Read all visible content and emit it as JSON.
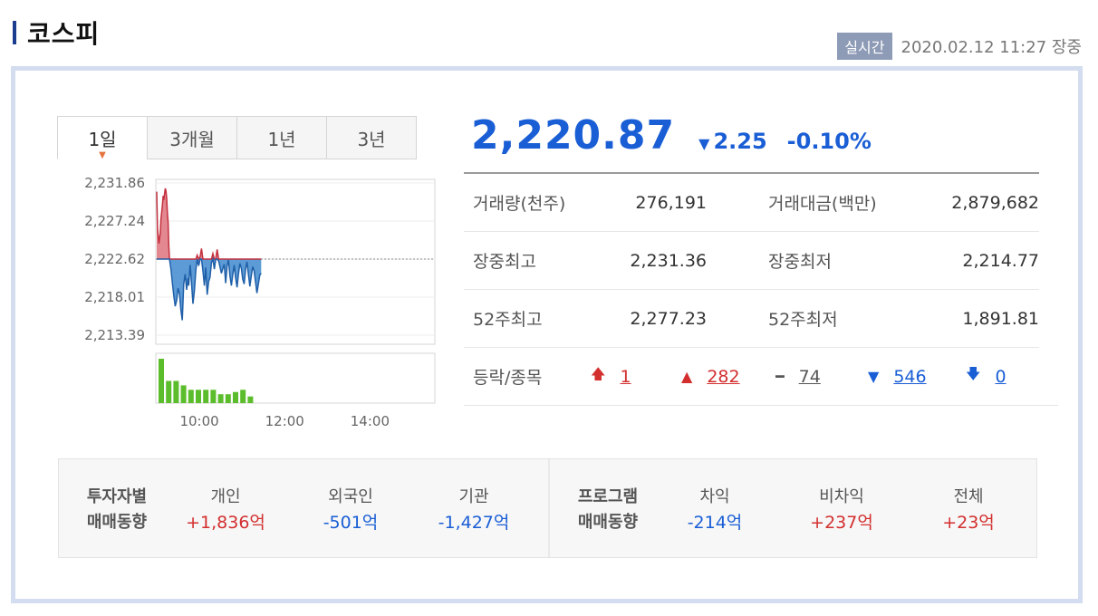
{
  "header": {
    "title": "코스피",
    "realtime_badge": "실시간",
    "timestamp": "2020.02.12 11:27 장중"
  },
  "tabs": [
    {
      "label": "1일",
      "active": true
    },
    {
      "label": "3개월",
      "active": false
    },
    {
      "label": "1년",
      "active": false
    },
    {
      "label": "3년",
      "active": false
    }
  ],
  "quote": {
    "price": "2,220.87",
    "direction": "down",
    "change": "2.25",
    "change_pct": "-0.10%"
  },
  "stats": {
    "volume_label": "거래량(천주)",
    "volume": "276,191",
    "amount_label": "거래대금(백만)",
    "amount": "2,879,682",
    "day_high_label": "장중최고",
    "day_high": "2,231.36",
    "day_low_label": "장중최저",
    "day_low": "2,214.77",
    "w52_high_label": "52주최고",
    "w52_high": "2,277.23",
    "w52_low_label": "52주최저",
    "w52_low": "1,891.81"
  },
  "updown": {
    "label": "등락/종목",
    "upper_limit": "1",
    "up": "282",
    "flat": "74",
    "down": "546",
    "lower_limit": "0"
  },
  "investors": {
    "group_label_1": "투자자별",
    "group_label_2": "매매동향",
    "individual_label": "개인",
    "individual": "+1,836억",
    "foreign_label": "외국인",
    "foreign": "-501억",
    "institution_label": "기관",
    "institution": "-1,427억"
  },
  "program": {
    "group_label_1": "프로그램",
    "group_label_2": "매매동향",
    "arb_label": "차익",
    "arb": "-214억",
    "nonarb_label": "비차익",
    "nonarb": "+237억",
    "total_label": "전체",
    "total": "+23억"
  },
  "colors": {
    "up": "#d32f2f",
    "down": "#1a5ed5",
    "volume": "#5bbd2b",
    "area_up": "#e07b84",
    "area_down": "#4a90d0"
  },
  "chart_data": {
    "type": "area",
    "baseline": 2222.62,
    "yticks": [
      "2,231.86",
      "2,227.24",
      "2,222.62",
      "2,218.01",
      "2,213.39"
    ],
    "ylim": [
      2213.39,
      2231.86
    ],
    "xticks": [
      "10:00",
      "12:00",
      "14:00"
    ],
    "x_minutes": [
      0,
      1,
      3,
      5,
      6,
      8,
      9,
      10,
      11,
      12,
      13,
      14,
      15,
      16,
      17,
      18,
      20,
      22,
      24,
      26,
      28,
      30,
      32,
      34,
      36,
      38,
      40,
      42,
      44,
      45,
      47,
      49,
      51,
      53,
      55,
      57,
      59,
      61,
      63,
      65,
      67,
      69,
      71,
      73,
      75,
      77,
      79,
      81,
      83,
      85,
      87,
      89,
      91,
      93,
      95,
      97,
      99,
      101,
      103,
      105,
      107,
      109,
      111,
      113,
      115,
      117,
      119,
      121,
      123,
      125,
      127,
      129,
      131,
      133,
      135,
      137,
      139,
      141,
      143,
      145,
      147
    ],
    "values": [
      2230.8,
      2226.4,
      2224.5,
      2225.8,
      2227.5,
      2229.2,
      2230.3,
      2229.8,
      2230.5,
      2231.2,
      2230.9,
      2230.0,
      2228.2,
      2227.1,
      2224.3,
      2222.6,
      2221.4,
      2219.7,
      2218.2,
      2216.9,
      2217.6,
      2219.1,
      2218.4,
      2216.4,
      2215.2,
      2219.6,
      2220.8,
      2218.9,
      2220.3,
      2219.4,
      2221.9,
      2219.7,
      2217.2,
      2218.8,
      2221.3,
      2223.1,
      2221.8,
      2222.9,
      2223.9,
      2221.2,
      2219.4,
      2221.6,
      2218.3,
      2219.9,
      2220.4,
      2222.2,
      2223.3,
      2221.4,
      2222.6,
      2223.8,
      2222.4,
      2221.7,
      2220.9,
      2221.5,
      2222.0,
      2219.7,
      2221.8,
      2222.5,
      2220.6,
      2219.4,
      2220.8,
      2221.9,
      2220.3,
      2219.2,
      2220.8,
      2222.1,
      2221.5,
      2220.2,
      2219.6,
      2221.4,
      2222.3,
      2220.8,
      2219.3,
      2220.6,
      2221.7,
      2221.2,
      2219.8,
      2218.5,
      2219.6,
      2220.7,
      2220.9
    ],
    "volume": [
      10,
      5,
      5,
      4,
      3,
      3,
      3,
      3,
      2,
      2,
      2.5,
      3,
      1.5
    ]
  }
}
